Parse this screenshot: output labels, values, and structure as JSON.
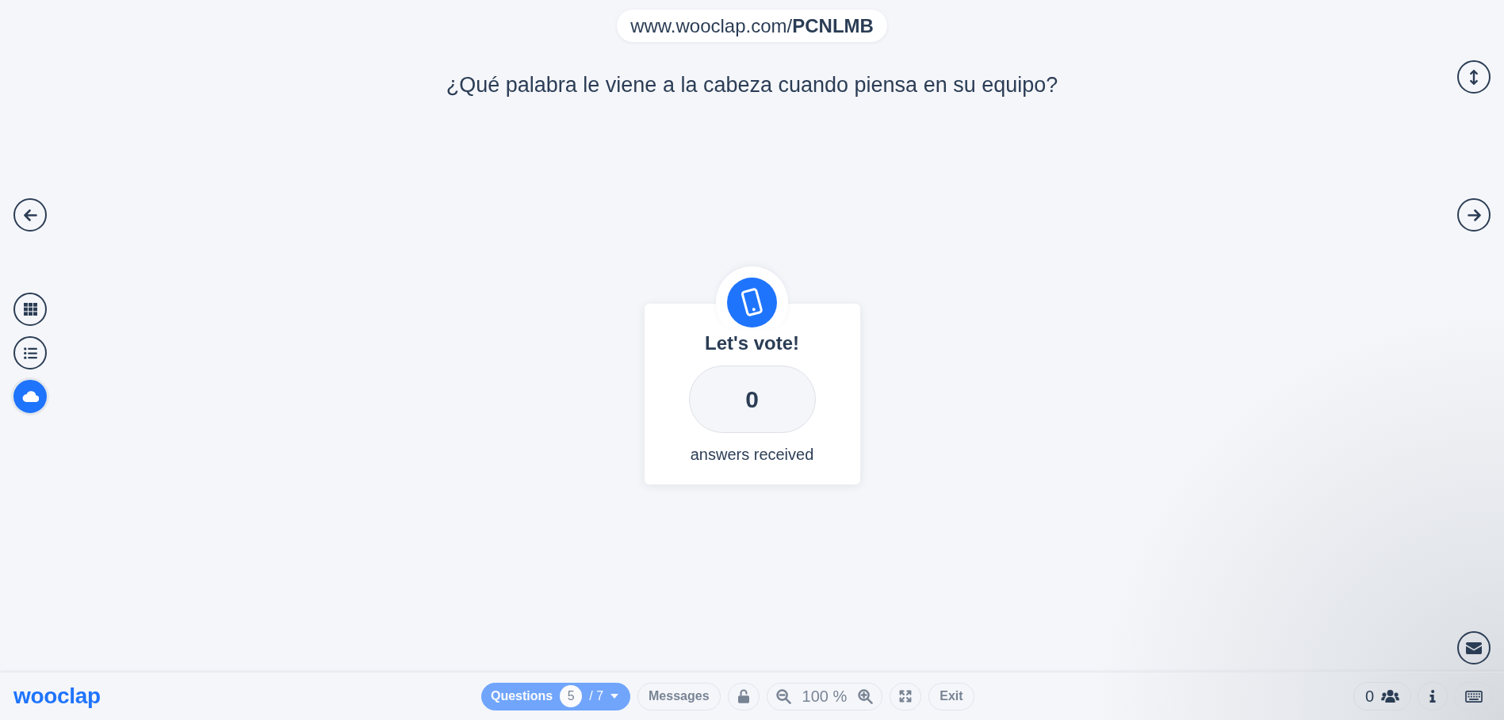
{
  "header": {
    "session_url": "www.wooclap.com/**PCNLMB**"
  },
  "question": "¿Qué palabra le viene a la cabeza cuando piensa en su equipo?",
  "view_buttons": [
    {
      "kind": "grid",
      "selected": false
    },
    {
      "kind": "list",
      "selected": false
    },
    {
      "kind": "cloud",
      "selected": true
    }
  ],
  "vote_card": {
    "title": "Let's vote!",
    "count": "0",
    "caption": "answers received"
  },
  "toolbar": {
    "logo": "wooclap",
    "controls": [
      {
        "kind": "questions",
        "label": "Questions",
        "current": "5",
        "total": "/ 7",
        "disabled": true
      },
      {
        "kind": "messages",
        "label": "Messages",
        "disabled": true
      },
      {
        "kind": "lock",
        "disabled": true
      },
      {
        "kind": "zoom",
        "value": "100 %",
        "disabled": true
      },
      {
        "kind": "fullscreen",
        "disabled": true
      },
      {
        "kind": "exit",
        "label": "Exit",
        "disabled": true
      }
    ],
    "participants": "0"
  }
}
